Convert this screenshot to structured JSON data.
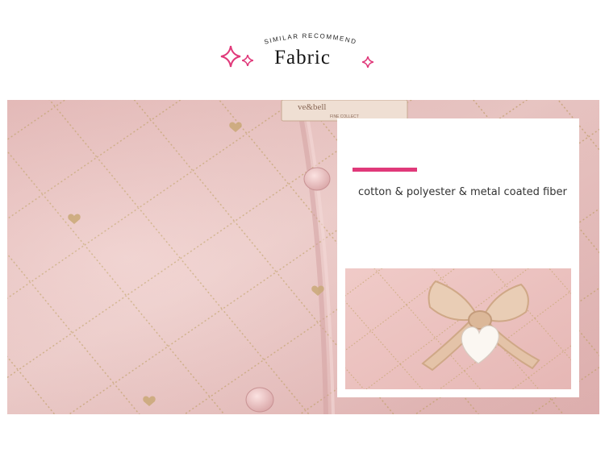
{
  "header": {
    "subtitle": "SIMILAR  RECOMMEND",
    "title": "Fabric",
    "sparkle_color": "#e0397a"
  },
  "photo": {
    "label_text_1": "ve&bell",
    "label_text_2": "FINE COLLECT",
    "fabric_color": "#ecc6c4",
    "stitch_color": "#c9a877"
  },
  "card": {
    "accent_color": "#e0397a",
    "material": "cotton & polyester & metal coated fiber"
  }
}
